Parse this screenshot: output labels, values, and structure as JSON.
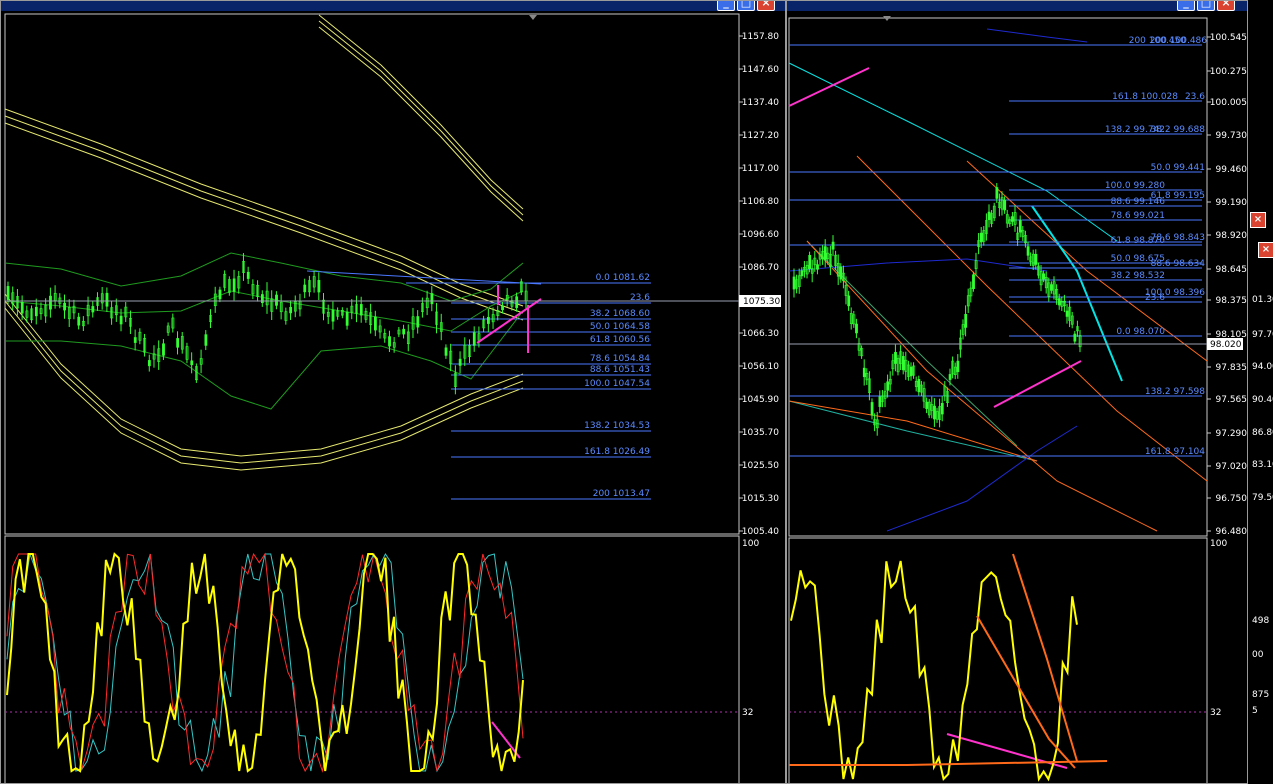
{
  "left_chart": {
    "price_scale": [
      "1157.80",
      "1147.60",
      "1137.40",
      "1127.20",
      "1117.00",
      "1106.80",
      "1096.60",
      "1086.70",
      "1066.30",
      "1056.10",
      "1045.90",
      "1035.70",
      "1025.50",
      "1015.30",
      "1005.40"
    ],
    "current_price": "1075.30",
    "fib_levels": [
      "0.0 1081.62",
      "23.6",
      "38.2 1068.60",
      "50.0 1064.58",
      "61.8 1060.56",
      "78.6 1054.84",
      "88.6 1051.43",
      "100.0 1047.54",
      "138.2 1034.53",
      "161.8 1026.49",
      "200 1013.47"
    ],
    "osc_scale": [
      "100",
      "32"
    ]
  },
  "right_chart": {
    "price_scale": [
      "100.545",
      "100.275",
      "100.005",
      "99.730",
      "99.460",
      "99.190",
      "98.920",
      "98.645",
      "98.375",
      "98.105",
      "97.835",
      "97.565",
      "97.290",
      "97.020",
      "96.750",
      "96.480"
    ],
    "current_price": "98.020",
    "fib_levels": [
      "200 100.450",
      "200 100.486",
      "161.8 100.028",
      "23.6",
      "138.2 99.742",
      "38.2 99.688",
      "50.0 99.441",
      "100.0 99.280",
      "61.8 99.195",
      "88.6 99.146",
      "78.6 99.021",
      "61.8 98.870",
      "78.6 98.843",
      "50.0 98.675",
      "88.6 98.634",
      "38.2 98.532",
      "100.0 98.396",
      "23.6",
      "0.0 98.070",
      "138.2 97.598",
      "161.8 97.104"
    ],
    "osc_scale": [
      "100",
      "32"
    ]
  },
  "background_window": {
    "labels": [
      "01.30",
      "97.70",
      "94.00",
      "90.40",
      "86.80",
      "83.10",
      "79.50",
      "498",
      "00",
      "875",
      "5"
    ]
  },
  "colors": {
    "candles": "#33ff33",
    "fib": "#4a78ff",
    "channel": "#e6e870",
    "stoch_main": "#ffff00",
    "stoch_signal": "#ff2a2a",
    "stoch_fast": "#35c6c6",
    "annotation": "#ff33cc",
    "trend_orange": "#ff6a1a",
    "trend_cyan": "#00e5e5"
  }
}
